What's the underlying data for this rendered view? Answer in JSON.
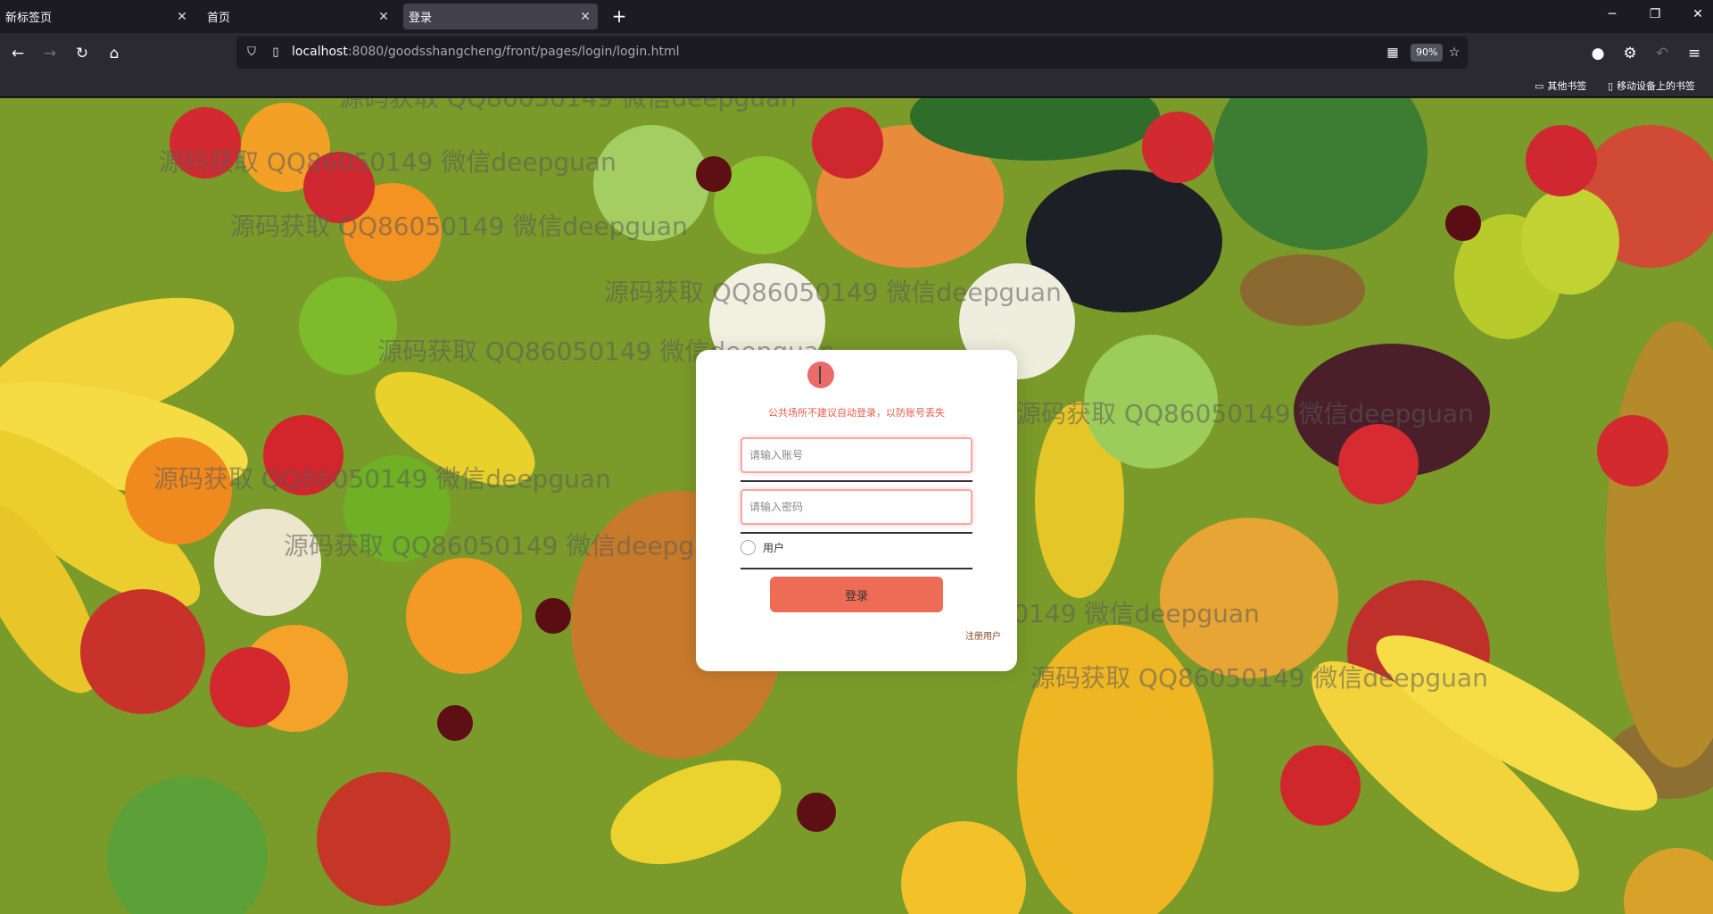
{
  "tabs": [
    {
      "title": "新标签页",
      "active": false
    },
    {
      "title": "首页",
      "active": false
    },
    {
      "title": "登录",
      "active": true
    }
  ],
  "window_controls": {
    "minimize": "─",
    "restore": "❐",
    "close": "✕"
  },
  "address": {
    "host": "localhost",
    "rest": ":8080/goodsshangcheng/front/pages/login/login.html",
    "zoom": "90%"
  },
  "bookmarks": {
    "other": "其他书签",
    "mobile": "移动设备上的书签"
  },
  "watermark_text": "源码获取 QQ86050149 微信deepguan",
  "login": {
    "warning": "公共场所不建议自动登录，以防账号丢失",
    "account_placeholder": "请输入账号",
    "password_placeholder": "请输入密码",
    "role_label": "用户",
    "login_label": "登录",
    "register_label": "注册用户"
  },
  "icons": {
    "back": "back-arrow-icon",
    "forward": "forward-arrow-icon",
    "reload": "reload-icon",
    "home": "home-icon"
  }
}
